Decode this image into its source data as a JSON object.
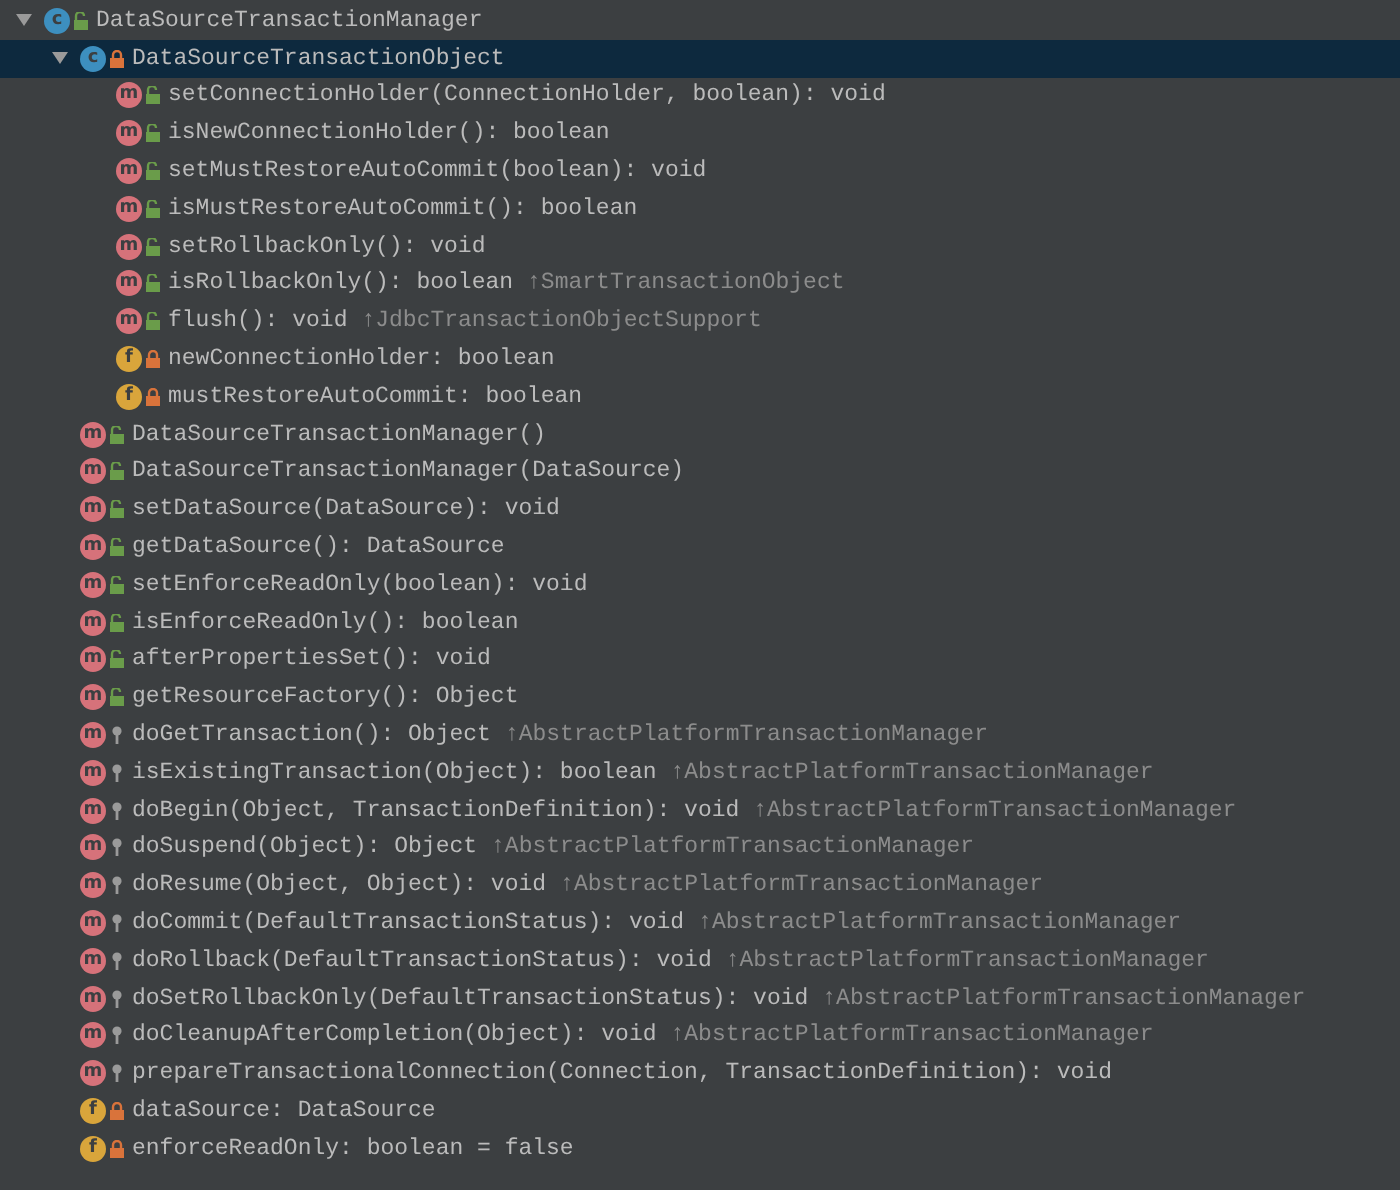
{
  "tree": [
    {
      "kind": "public-class",
      "badge": "c",
      "text": "DataSourceTransactionManager",
      "expanded": true,
      "selected": false,
      "children": [
        {
          "kind": "private-class",
          "badge": "c",
          "text": "DataSourceTransactionObject",
          "expanded": true,
          "selected": true,
          "children": [
            {
              "kind": "public-method",
              "badge": "m",
              "text": "setConnectionHolder(ConnectionHolder, boolean): void",
              "selected": false
            },
            {
              "kind": "public-method",
              "badge": "m",
              "text": "isNewConnectionHolder(): boolean",
              "selected": false
            },
            {
              "kind": "public-method",
              "badge": "m",
              "text": "setMustRestoreAutoCommit(boolean): void",
              "selected": false
            },
            {
              "kind": "public-method",
              "badge": "m",
              "text": "isMustRestoreAutoCommit(): boolean",
              "selected": false
            },
            {
              "kind": "public-method",
              "badge": "m",
              "text": "setRollbackOnly(): void",
              "selected": false
            },
            {
              "kind": "public-method",
              "badge": "m",
              "text": "isRollbackOnly(): boolean",
              "inherited": "↑SmartTransactionObject",
              "selected": false
            },
            {
              "kind": "public-method",
              "badge": "m",
              "text": "flush(): void",
              "inherited": "↑JdbcTransactionObjectSupport",
              "selected": false
            },
            {
              "kind": "private-field",
              "badge": "f",
              "text": "newConnectionHolder: boolean",
              "selected": false
            },
            {
              "kind": "private-field",
              "badge": "f",
              "text": "mustRestoreAutoCommit: boolean",
              "selected": false
            }
          ]
        },
        {
          "kind": "public-method",
          "badge": "m",
          "text": "DataSourceTransactionManager()",
          "selected": false
        },
        {
          "kind": "public-method",
          "badge": "m",
          "text": "DataSourceTransactionManager(DataSource)",
          "selected": false
        },
        {
          "kind": "public-method",
          "badge": "m",
          "text": "setDataSource(DataSource): void",
          "selected": false
        },
        {
          "kind": "public-method",
          "badge": "m",
          "text": "getDataSource(): DataSource",
          "selected": false
        },
        {
          "kind": "public-method",
          "badge": "m",
          "text": "setEnforceReadOnly(boolean): void",
          "selected": false
        },
        {
          "kind": "public-method",
          "badge": "m",
          "text": "isEnforceReadOnly(): boolean",
          "selected": false
        },
        {
          "kind": "public-method",
          "badge": "m",
          "text": "afterPropertiesSet(): void",
          "selected": false
        },
        {
          "kind": "public-method",
          "badge": "m",
          "text": "getResourceFactory(): Object",
          "selected": false
        },
        {
          "kind": "protected-method",
          "badge": "m",
          "text": "doGetTransaction(): Object",
          "inherited": "↑AbstractPlatformTransactionManager",
          "selected": false
        },
        {
          "kind": "protected-method",
          "badge": "m",
          "text": "isExistingTransaction(Object): boolean",
          "inherited": "↑AbstractPlatformTransactionManager",
          "selected": false
        },
        {
          "kind": "protected-method",
          "badge": "m",
          "text": "doBegin(Object, TransactionDefinition): void",
          "inherited": "↑AbstractPlatformTransactionManager",
          "selected": false
        },
        {
          "kind": "protected-method",
          "badge": "m",
          "text": "doSuspend(Object): Object",
          "inherited": "↑AbstractPlatformTransactionManager",
          "selected": false
        },
        {
          "kind": "protected-method",
          "badge": "m",
          "text": "doResume(Object, Object): void",
          "inherited": "↑AbstractPlatformTransactionManager",
          "selected": false
        },
        {
          "kind": "protected-method",
          "badge": "m",
          "text": "doCommit(DefaultTransactionStatus): void",
          "inherited": "↑AbstractPlatformTransactionManager",
          "selected": false
        },
        {
          "kind": "protected-method",
          "badge": "m",
          "text": "doRollback(DefaultTransactionStatus): void",
          "inherited": "↑AbstractPlatformTransactionManager",
          "selected": false
        },
        {
          "kind": "protected-method",
          "badge": "m",
          "text": "doSetRollbackOnly(DefaultTransactionStatus): void",
          "inherited": "↑AbstractPlatformTransactionManager",
          "selected": false
        },
        {
          "kind": "protected-method",
          "badge": "m",
          "text": "doCleanupAfterCompletion(Object): void",
          "inherited": "↑AbstractPlatformTransactionManager",
          "selected": false
        },
        {
          "kind": "protected-method",
          "badge": "m",
          "text": "prepareTransactionalConnection(Connection, TransactionDefinition): void",
          "selected": false
        },
        {
          "kind": "private-field",
          "badge": "f",
          "text": "dataSource: DataSource",
          "selected": false
        },
        {
          "kind": "private-field",
          "badge": "f",
          "text": "enforceReadOnly: boolean = false",
          "selected": false
        }
      ]
    }
  ]
}
